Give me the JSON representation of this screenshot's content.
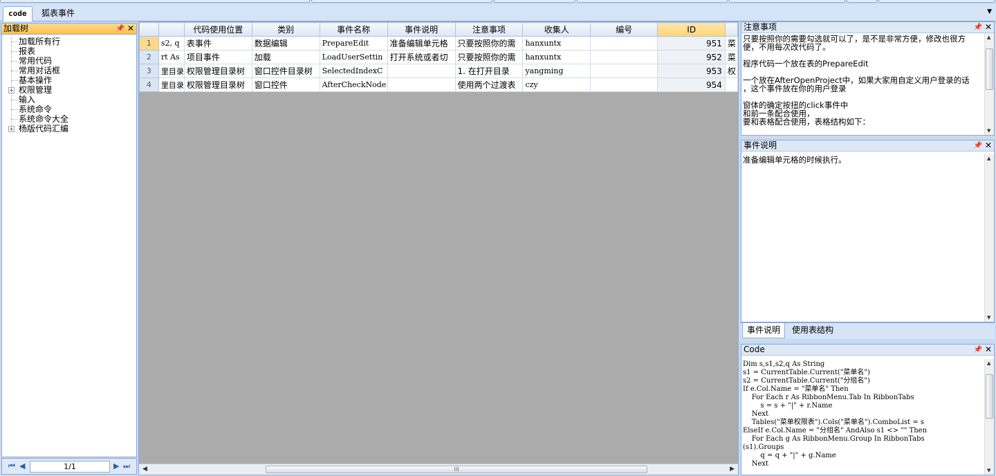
{
  "tabs": [
    {
      "label": "code",
      "active": true
    },
    {
      "label": "狐表事件",
      "active": false
    }
  ],
  "tree_panel": {
    "title": "加载树",
    "items": [
      {
        "label": "加载所有行",
        "expandable": false
      },
      {
        "label": "报表",
        "expandable": false
      },
      {
        "label": "常用代码",
        "expandable": false
      },
      {
        "label": "常用对话框",
        "expandable": false
      },
      {
        "label": "基本操作",
        "expandable": false
      },
      {
        "label": "权限管理",
        "expandable": true
      },
      {
        "label": "输入",
        "expandable": false
      },
      {
        "label": "系统命令",
        "expandable": false
      },
      {
        "label": "系统命令大全",
        "expandable": false
      },
      {
        "label": "杨版代码汇编",
        "expandable": true
      }
    ],
    "pager": {
      "page_text": "1/1"
    }
  },
  "grid": {
    "columns": [
      "",
      "",
      "代码使用位置",
      "类别",
      "事件名称",
      "事件说明",
      "注意事项",
      "收集人",
      "编号",
      "ID",
      ""
    ],
    "rows": [
      {
        "n": "1",
        "c0": "s2, q",
        "c1": "表事件",
        "c2": "数据编辑",
        "c3": "PrepareEdit",
        "c4": "准备编辑单元格",
        "c5": "只要按照你的需",
        "c6": "hanxuntx",
        "c7": "",
        "c8": "951",
        "c9": "菜"
      },
      {
        "n": "2",
        "c0": "rt As",
        "c1": "项目事件",
        "c2": "加载",
        "c3": "LoadUserSettin",
        "c4": "打开系统或者切",
        "c5": "只要按照你的需",
        "c6": "hanxuntx",
        "c7": "",
        "c8": "952",
        "c9": "菜"
      },
      {
        "n": "3",
        "c0": "里目录",
        "c1": "权限管理目录树",
        "c2": "窗口控件目录树",
        "c3": "SelectedIndexC",
        "c4": "",
        "c5": "1. 在打开目录",
        "c6": "yangming",
        "c7": "",
        "c8": "953",
        "c9": "权"
      },
      {
        "n": "4",
        "c0": "里目录",
        "c1": "权限管理目录树",
        "c2": "窗口控件",
        "c3": "AfterCheckNode",
        "c4": "",
        "c5": "使用两个过渡表",
        "c6": "czy",
        "c7": "",
        "c8": "954",
        "c9": ""
      }
    ],
    "scroll_grip": "III"
  },
  "notes_panel": {
    "title": "注意事项",
    "lines": [
      "只要按照你的需要勾选就可以了，是不是非常方便，修改也很方",
      "便，不用每次改代码了。",
      "",
      "程序代码一个放在表的PrepareEdit",
      "",
      "一个放在AfterOpenProject中，如果大家用自定义用户登录的话",
      "，这个事件放在你的用户登录",
      "",
      "窗体的确定按扭的click事件中",
      "和前一条配合使用，",
      "要和表格配合使用，表格结构如下："
    ]
  },
  "desc_panel": {
    "title": "事件说明",
    "text": "准备编辑单元格的时候执行。"
  },
  "sub_tabs": [
    {
      "label": "事件说明",
      "active": true
    },
    {
      "label": "使用表结构",
      "active": false
    }
  ],
  "code_panel": {
    "title": "Code",
    "lines": [
      "Dim s,s1,s2,q As String",
      "s1 = CurrentTable.Current(\"菜单名\")",
      "s2 = CurrentTable.Current(\"分组名\")",
      "If e.Col.Name = \"菜单名\" Then",
      "    For Each r As RibbonMenu.Tab In RibbonTabs",
      "        s = s + \"|\" + r.Name",
      "    Next",
      "    Tables(\"菜单权限表\").Cols(\"菜单名\").ComboList = s",
      "ElseIf e.Col.Name = \"分组名\" AndAlso s1 <> \"\" Then",
      "    For Each g As RibbonMenu.Group In RibbonTabs",
      "(s1).Groups",
      "        q = q + \"|\" + g.Name",
      "    Next"
    ]
  },
  "icons": {
    "pin": "pin-icon",
    "close": "close-icon",
    "expand": "plus-box-icon",
    "dropdown": "chevron-down-icon"
  }
}
